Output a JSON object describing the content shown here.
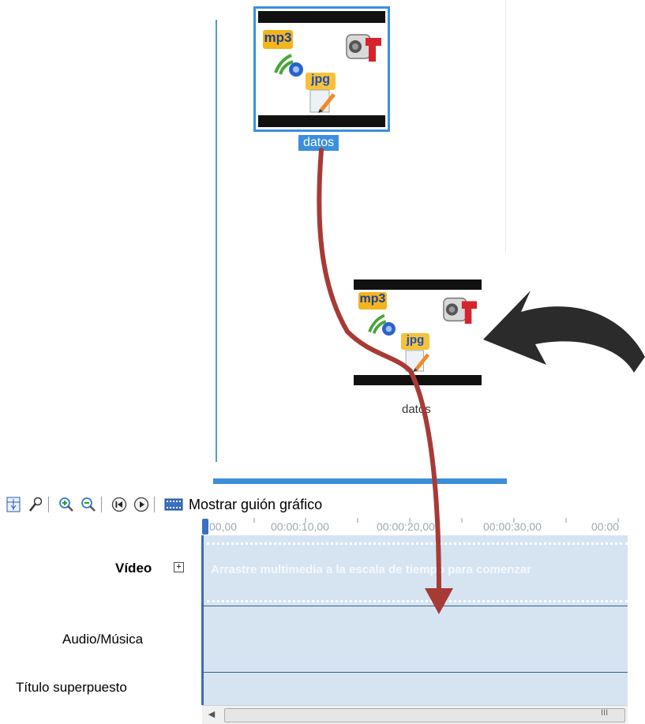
{
  "collection": {
    "selected_item": {
      "label": "datos",
      "badges": {
        "mp3": "mp3",
        "jpg": "jpg"
      }
    },
    "dragged_item": {
      "label": "datos",
      "badges": {
        "mp3": "mp3",
        "jpg": "jpg"
      }
    }
  },
  "toolbar": {
    "storyboard_label": "Mostrar guión gráfico",
    "icons": [
      "timeline-options-icon",
      "narrate-microphone-icon",
      "zoom-in-icon",
      "zoom-out-icon",
      "rewind-icon",
      "play-icon",
      "storyboard-film-icon"
    ]
  },
  "timeline": {
    "ruler_ticks": [
      "00,00",
      "00:00:10,00",
      "00:00:20,00",
      "00:00:30,00",
      "00:00"
    ],
    "tracks": {
      "video": "Vídeo",
      "audio": "Audio/Música",
      "title_overlay": "Título superpuesto"
    },
    "expand_symbol": "+",
    "drop_hint": "Arrastre multimedia a la escala de tiempo para comenzar",
    "scroll_grip": "III"
  },
  "colors": {
    "selection": "#3b8fe0",
    "track_background": "#d6e4f2",
    "drag_arrow": "#a83a36",
    "curved_arrow": "#2b2b2b"
  }
}
